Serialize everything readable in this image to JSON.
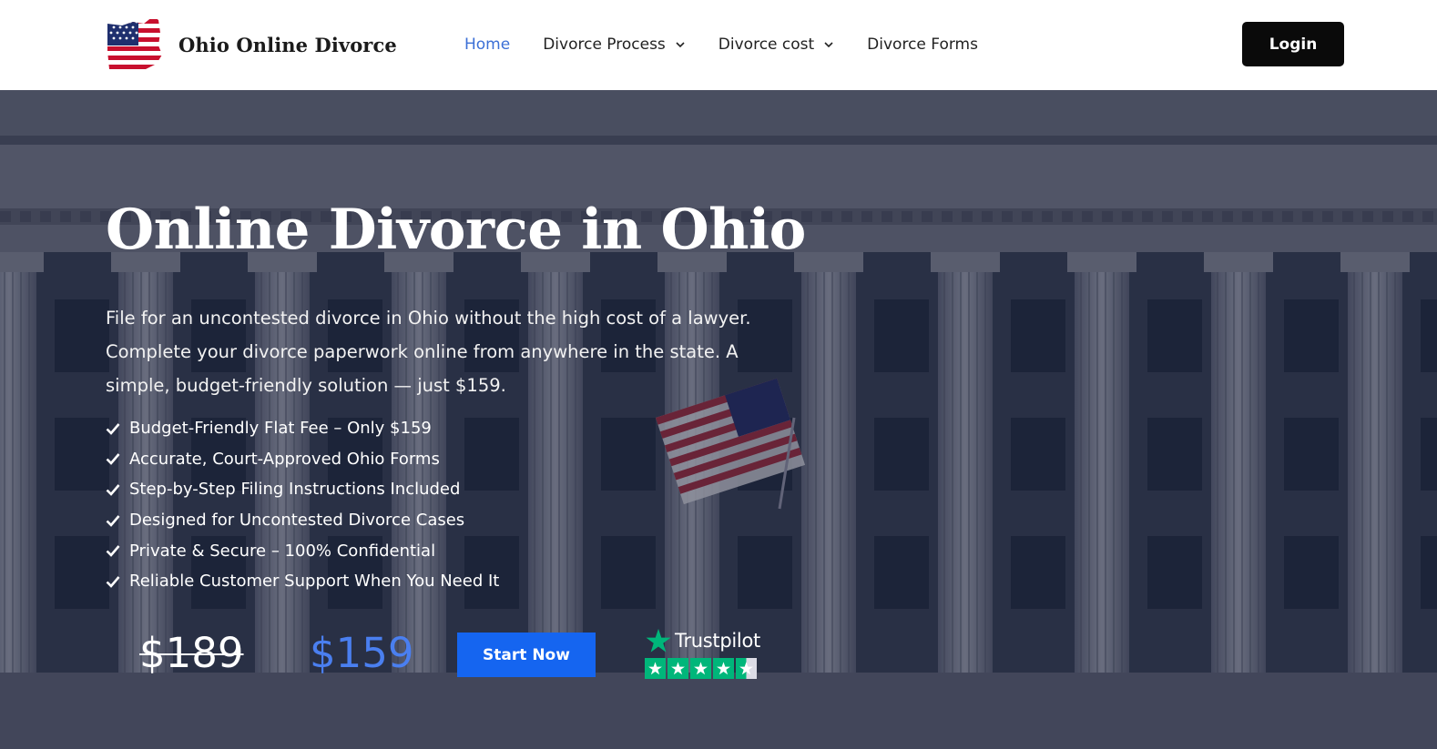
{
  "header": {
    "brand": "Ohio Online Divorce",
    "nav": [
      {
        "label": "Home",
        "active": true,
        "dropdown": false
      },
      {
        "label": "Divorce Process",
        "active": false,
        "dropdown": true
      },
      {
        "label": "Divorce cost",
        "active": false,
        "dropdown": true
      },
      {
        "label": "Divorce Forms",
        "active": false,
        "dropdown": false
      }
    ],
    "login_label": "Login"
  },
  "hero": {
    "title": "Online Divorce in Ohio",
    "description": "File for an uncontested divorce in Ohio without the high cost of a lawyer. Complete your divorce paperwork online from anywhere in the state. A simple, budget-friendly solution — just $159.",
    "features": [
      "Budget-Friendly Flat Fee – Only $159",
      "Accurate, Court-Approved Ohio Forms",
      "Step-by-Step Filing Instructions Included",
      "Designed for Uncontested Divorce Cases",
      "Private & Secure – 100% Confidential",
      "Reliable Customer Support When You Need It"
    ],
    "price_old": "$189",
    "price_new": "$159",
    "cta_label": "Start Now"
  },
  "trustpilot": {
    "name": "Trustpilot",
    "rating": 4.5,
    "max": 5
  },
  "colors": {
    "accent": "#1565f0",
    "nav_active": "#3b6fd6",
    "price_new": "#4a7ff0",
    "trustpilot_green": "#00b67a",
    "login_bg": "#0a0a0a"
  },
  "icons": [
    "ohio-flag-logo-icon",
    "chevron-down-icon",
    "check-icon",
    "trustpilot-star-icon"
  ]
}
